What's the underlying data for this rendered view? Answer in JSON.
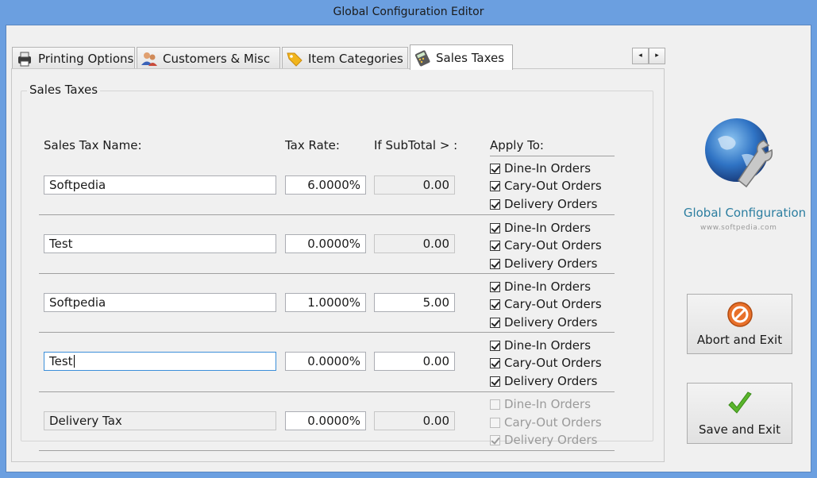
{
  "window": {
    "title": "Global Configuration Editor"
  },
  "tabs": [
    {
      "label": "Printing Options",
      "icon": "printer-icon"
    },
    {
      "label": "Customers & Misc",
      "icon": "customers-icon"
    },
    {
      "label": "Item Categories",
      "icon": "tag-icon"
    },
    {
      "label": "Sales Taxes",
      "icon": "calculator-icon",
      "active": true
    }
  ],
  "group_label": "Sales Taxes",
  "headers": {
    "name": "Sales Tax Name:",
    "rate": "Tax Rate:",
    "subtotal": "If SubTotal > :",
    "apply": "Apply To:"
  },
  "apply_labels": [
    "Dine-In Orders",
    "Cary-Out Orders",
    "Delivery Orders"
  ],
  "rows": [
    {
      "name": "Softpedia",
      "rate": "6.0000%",
      "subtotal": "0.00",
      "subtotal_readonly": true,
      "checks": [
        true,
        true,
        true
      ],
      "disabled": false
    },
    {
      "name": "Test",
      "rate": "0.0000%",
      "subtotal": "0.00",
      "subtotal_readonly": true,
      "checks": [
        true,
        true,
        true
      ],
      "disabled": false
    },
    {
      "name": "Softpedia",
      "rate": "1.0000%",
      "subtotal": "5.00",
      "subtotal_readonly": false,
      "checks": [
        true,
        true,
        true
      ],
      "disabled": false
    },
    {
      "name": "Test",
      "rate": "0.0000%",
      "subtotal": "0.00",
      "subtotal_readonly": false,
      "checks": [
        true,
        true,
        true
      ],
      "disabled": false,
      "focused": true
    },
    {
      "name": "Delivery Tax",
      "rate": "0.0000%",
      "subtotal": "0.00",
      "subtotal_readonly": true,
      "checks": [
        false,
        false,
        true
      ],
      "disabled": true
    }
  ],
  "side": {
    "title": "Global Configuration",
    "watermark": "www.softpedia.com",
    "abort_label": "Abort and Exit",
    "save_label": "Save and Exit"
  },
  "colors": {
    "titlebar": "#6b9fe0",
    "accent_text": "#2c7ea0",
    "abort_icon": "#e8702a",
    "save_icon": "#5ab52c"
  }
}
